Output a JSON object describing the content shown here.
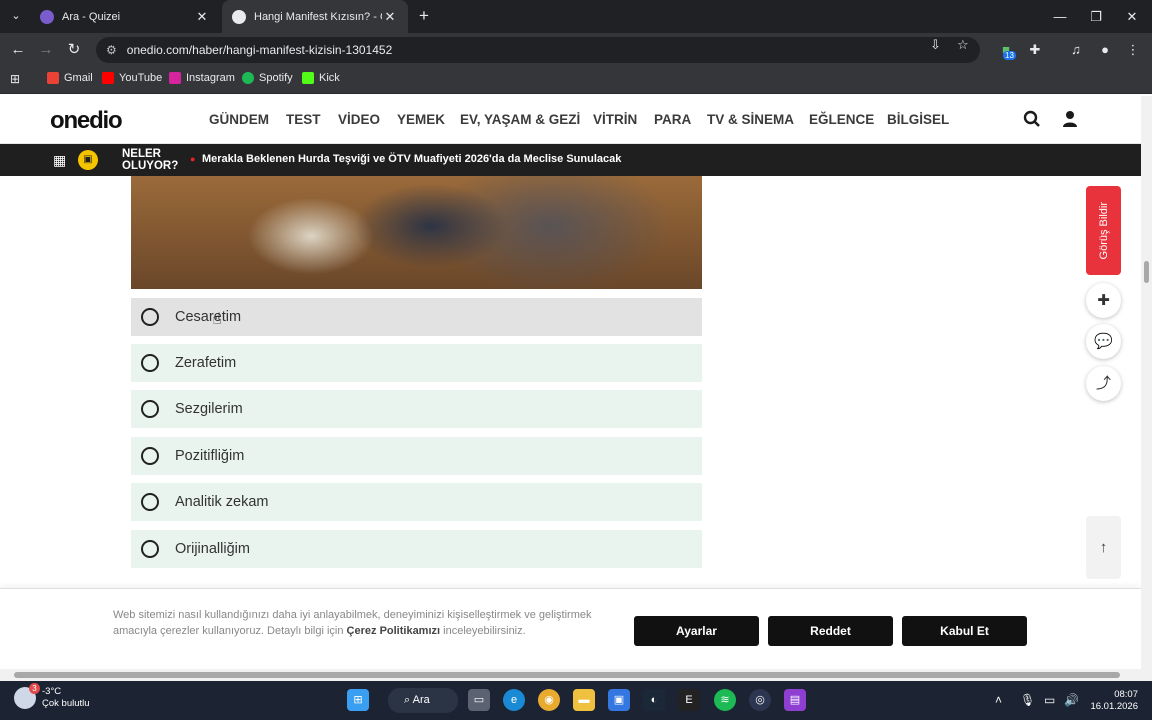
{
  "browser": {
    "tabs": [
      {
        "title": "Ara - Quizei",
        "active": false
      },
      {
        "title": "Hangi Manifest Kızısın? - Onedio",
        "active": true
      }
    ],
    "url": "onedio.com/haber/hangi-manifest-kizisin-1301452",
    "bookmarks": [
      "Gmail",
      "YouTube",
      "Instagram",
      "Spotify",
      "Kick"
    ],
    "extension_badge": "13"
  },
  "site": {
    "logo": "onedio",
    "nav": [
      "GÜNDEM",
      "TEST",
      "VİDEO",
      "YEMEK",
      "EV, YAŞAM & GEZİ",
      "VİTRİN",
      "PARA",
      "TV & SİNEMA",
      "EĞLENCE",
      "BİLGİSEL"
    ],
    "ticker": {
      "label": "NELER OLUYOR?",
      "headline": "Merakla Beklenen Hurda Teşviği ve ÖTV Muafiyeti 2026'da da Meclise Sunulacak"
    }
  },
  "quiz": {
    "answers": [
      "Cesaretim",
      "Zerafetim",
      "Sezgilerim",
      "Pozitifliğim",
      "Analitik zekam",
      "Orijinalliğim"
    ]
  },
  "rail": {
    "feedback": "Görüş Bildir"
  },
  "cookie": {
    "text_part1": "Web sitemizi nasıl kullandığınızı daha iyi anlayabilmek, deneyiminizi kişiselleştirmek ve geliştirmek amacıyla çerezler kullanıyoruz. Detaylı bilgi için ",
    "policy_link": "Çerez Politikamızı",
    "text_part2": " inceleyebilirsiniz.",
    "buttons": {
      "settings": "Ayarlar",
      "reject": "Reddet",
      "accept": "Kabul Et"
    }
  },
  "taskbar": {
    "weather_temp": "-3°C",
    "weather_desc": "Çok bulutlu",
    "weather_badge": "3",
    "search_label": "Ara",
    "time": "08:07",
    "date": "16.01.2026"
  }
}
